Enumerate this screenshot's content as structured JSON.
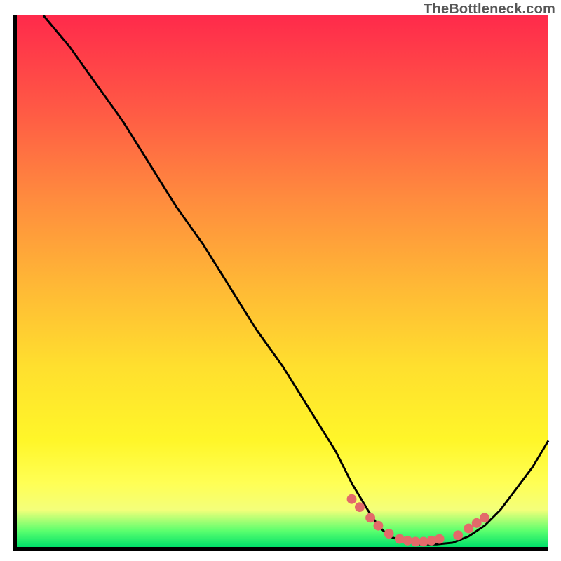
{
  "attribution": "TheBottleneck.com",
  "chart_data": {
    "type": "line",
    "title": "",
    "xlabel": "",
    "ylabel": "",
    "xlim": [
      0,
      100
    ],
    "ylim": [
      0,
      100
    ],
    "series": [
      {
        "name": "bottleneck-curve",
        "x": [
          5,
          10,
          15,
          20,
          25,
          30,
          35,
          40,
          45,
          50,
          55,
          60,
          63,
          66,
          68,
          70,
          73,
          76,
          79,
          82,
          85,
          88,
          91,
          94,
          97,
          100
        ],
        "y": [
          100,
          94,
          87,
          80,
          72,
          64,
          57,
          49,
          41,
          34,
          26,
          18,
          12,
          7,
          4,
          2,
          1,
          0.5,
          0.5,
          0.8,
          2,
          4,
          7,
          11,
          15,
          20
        ]
      }
    ],
    "markers": {
      "name": "optimal-range-markers",
      "x": [
        63,
        64.5,
        66.5,
        68,
        70,
        72,
        73.5,
        75,
        76.5,
        78,
        79.5,
        83,
        85,
        86.5,
        88
      ],
      "y": [
        9,
        7.5,
        5.5,
        4,
        2.5,
        1.5,
        1.2,
        1,
        1,
        1.2,
        1.5,
        2.2,
        3.5,
        4.5,
        5.5
      ]
    },
    "colors": {
      "curve": "#000000",
      "marker": "#e36a6a",
      "gradient_top": "#ff2a4b",
      "gradient_mid": "#ffde2e",
      "gradient_bottom": "#00e06a"
    }
  }
}
